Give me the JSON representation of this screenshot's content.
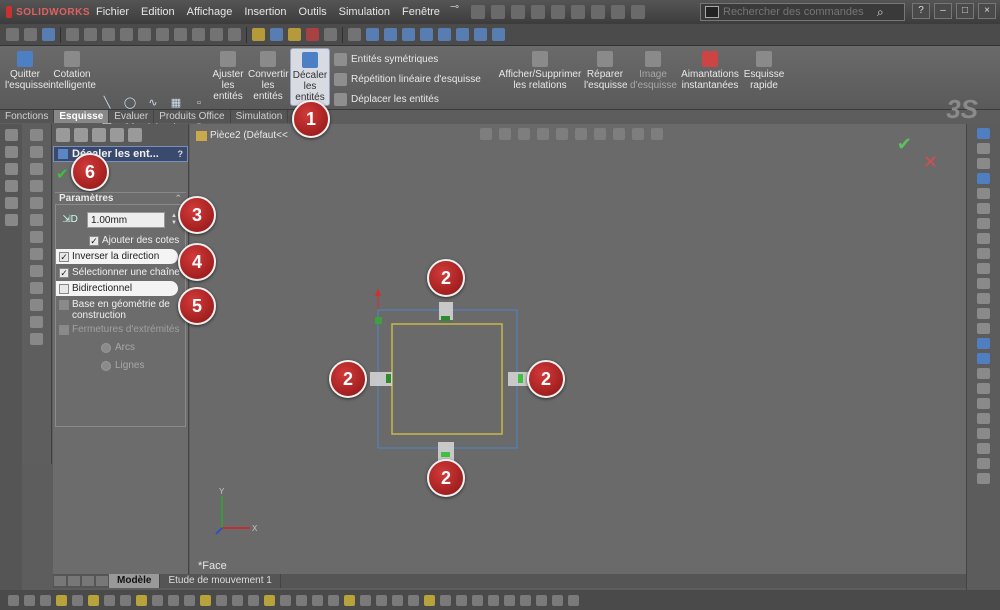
{
  "app": {
    "logo": "SOLIDWORKS"
  },
  "menu": [
    "Fichier",
    "Edition",
    "Affichage",
    "Insertion",
    "Outils",
    "Simulation",
    "Fenêtre"
  ],
  "search": {
    "placeholder": "Rechercher des commandes"
  },
  "window_buttons": [
    "?",
    "–",
    "□",
    "×"
  ],
  "ribbon": {
    "quit_sketch": "Quitter l'esquisse",
    "smart_dim": "Cotation intelligente",
    "trim": "Ajuster les entités",
    "convert": "Convertir les entités",
    "offset": "Décaler les entités",
    "mirror": "Entités symétriques",
    "linear_pattern": "Répétition linéaire d'esquisse",
    "move": "Déplacer les entités",
    "relations": "Afficher/Supprimer les relations",
    "repair": "Réparer l'esquisse",
    "sketch_image": "Image d'esquisse",
    "snaps": "Aimantations instantanées",
    "rapid_sketch": "Esquisse rapide"
  },
  "tabs": [
    "Fonctions",
    "Esquisse",
    "Evaluer",
    "Produits Office",
    "Simulation"
  ],
  "active_tab": "Esquisse",
  "tree": {
    "label": "Pièce2  (Défaut<<"
  },
  "property_manager": {
    "title": "Décaler les ent...",
    "group": "Paramètres",
    "distance": "1.00mm",
    "add_dims": "Ajouter des cotes",
    "reverse": "Inverser la direction",
    "select_chain": "Sélectionner une chaîne",
    "bidirectional": "Bidirectionnel",
    "construction": "Base en géométrie de construction",
    "end_caps": "Fermetures d'extrémités",
    "arcs": "Arcs",
    "lines": "Lignes"
  },
  "graphics": {
    "face_label": "*Face",
    "axis_x": "X",
    "axis_y": "Y"
  },
  "bottom_tabs": [
    "Modèle",
    "Etude de mouvement 1"
  ],
  "callouts": {
    "c1": "1",
    "c2": "2",
    "c3": "3",
    "c4": "4",
    "c5": "5",
    "c6": "6"
  },
  "colors": {
    "accent": "#4d7fc4",
    "callout": "#b01e1e",
    "sketch_outer": "#4f86c6",
    "sketch_inner": "#c8b84a"
  }
}
